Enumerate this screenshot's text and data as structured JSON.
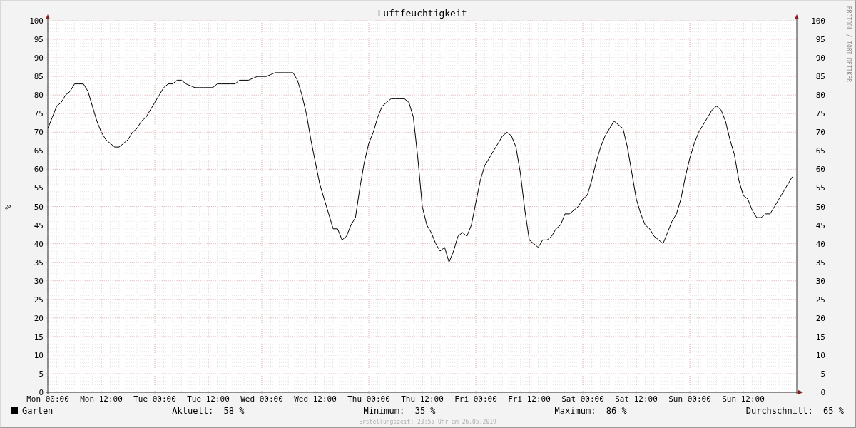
{
  "graph": {
    "chart_data": {
      "type": "line",
      "grid": true,
      "title": "Luftfeuchtigkeit",
      "ylabel": "%",
      "ylim": [
        0,
        100
      ],
      "categories": [
        "Mon 00:00",
        null,
        null,
        null,
        null,
        null,
        null,
        null,
        null,
        null,
        null,
        null,
        "Mon 12:00",
        null,
        null,
        null,
        null,
        null,
        null,
        null,
        null,
        null,
        null,
        null,
        "Tue 00:00",
        null,
        null,
        null,
        null,
        null,
        null,
        null,
        null,
        null,
        null,
        null,
        "Tue 12:00",
        null,
        null,
        null,
        null,
        null,
        null,
        null,
        null,
        null,
        null,
        null,
        "Wed 00:00",
        null,
        null,
        null,
        null,
        null,
        null,
        null,
        null,
        null,
        null,
        null,
        "Wed 12:00",
        null,
        null,
        null,
        null,
        null,
        null,
        null,
        null,
        null,
        null,
        null,
        "Thu 00:00",
        null,
        null,
        null,
        null,
        null,
        null,
        null,
        null,
        null,
        null,
        null,
        "Thu 12:00",
        null,
        null,
        null,
        null,
        null,
        null,
        null,
        null,
        null,
        null,
        null,
        "Fri 00:00",
        null,
        null,
        null,
        null,
        null,
        null,
        null,
        null,
        null,
        null,
        null,
        "Fri 12:00",
        null,
        null,
        null,
        null,
        null,
        null,
        null,
        null,
        null,
        null,
        null,
        "Sat 00:00",
        null,
        null,
        null,
        null,
        null,
        null,
        null,
        null,
        null,
        null,
        null,
        "Sat 12:00",
        null,
        null,
        null,
        null,
        null,
        null,
        null,
        null,
        null,
        null,
        null,
        "Sun 00:00",
        null,
        null,
        null,
        null,
        null,
        null,
        null,
        null,
        null,
        null,
        null,
        "Sun 12:00",
        null,
        null,
        null,
        null,
        null,
        null,
        null,
        null,
        null,
        null,
        null
      ],
      "yticks": [
        0,
        5,
        10,
        15,
        20,
        25,
        30,
        35,
        40,
        45,
        50,
        55,
        60,
        65,
        70,
        75,
        80,
        85,
        90,
        95,
        100
      ],
      "series": [
        {
          "name": "Garten",
          "color": "#000000",
          "values": [
            71,
            74,
            77,
            78,
            80,
            81,
            83,
            83,
            83,
            81,
            77,
            73,
            70,
            68,
            67,
            66,
            66,
            67,
            68,
            70,
            71,
            73,
            74,
            76,
            78,
            80,
            82,
            83,
            83,
            84,
            84,
            83,
            82.5,
            82,
            82,
            82,
            82,
            82,
            83,
            83,
            83,
            83,
            83,
            84,
            84,
            84,
            84.5,
            85,
            85,
            85,
            85.5,
            86,
            86,
            86,
            86,
            86,
            84,
            80,
            75,
            68,
            62,
            56,
            52,
            48,
            44,
            44,
            41,
            42,
            45,
            47,
            55,
            62,
            67,
            70,
            74,
            77,
            78,
            79,
            79,
            79,
            79,
            78,
            74,
            63,
            50,
            45,
            43,
            40,
            38,
            39,
            35,
            38,
            42,
            43,
            42,
            45,
            51,
            57,
            61,
            63,
            65,
            67,
            69,
            70,
            69,
            66,
            59,
            49,
            41,
            40,
            39,
            41,
            41,
            42,
            44,
            45,
            48,
            48,
            49,
            50,
            52,
            53,
            57,
            62,
            66,
            69,
            71,
            73,
            72,
            71,
            66,
            59,
            52,
            48,
            45,
            44,
            42,
            41,
            40,
            43,
            46,
            48,
            52,
            58,
            63,
            67,
            70,
            72,
            74,
            76,
            77,
            76,
            73,
            68,
            64,
            57,
            53,
            52,
            49,
            47,
            47,
            48,
            48,
            50,
            52,
            54,
            56,
            58
          ]
        }
      ]
    },
    "right_axis_labels": [
      "100",
      "95",
      "90",
      "85",
      "80",
      "75",
      "70",
      "65",
      "60",
      "55",
      "50",
      "45",
      "40",
      "35",
      "30",
      "25",
      "20",
      "15",
      "10",
      "5",
      "0"
    ],
    "side_text": "RRDTOOL / TOBI OETIKER"
  },
  "stats": [
    {
      "label": "Aktuell:",
      "value": "58 %"
    },
    {
      "label": "Minimum:",
      "value": "35 %"
    },
    {
      "label": "Maximum:",
      "value": "86 %"
    },
    {
      "label": "Durchschnitt:",
      "value": "65 %"
    }
  ],
  "footer": "Erstellungszeit: 23:55 Uhr am 26.05.2019"
}
